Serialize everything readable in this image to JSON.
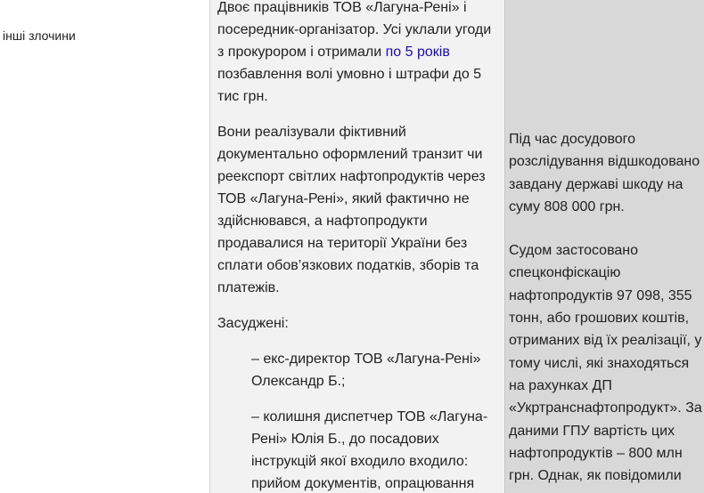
{
  "col1": {
    "label": "інші злочини"
  },
  "col2": {
    "p1_a": "Двоє працівників ТОВ «Лагуна-Рені» і посередник-організатор. Усі уклали угоди з прокурором і отримали ",
    "p1_link": "по 5 років",
    "p1_b": " позбавлення волі умовно і штрафи до 5 тис грн.",
    "p2": "Вони реалізували фіктивний документально оформлений транзит чи реекспорт світлих нафтопродуктів через ТОВ «Лагуна-Рені», який фактично не здійснювався, а нафтопродукти продавалися на території України без сплати обов’язкових податків, зборів та платежів.",
    "p3": "Засуджені:",
    "p4": "– екс-директор ТОВ «Лагуна-Рені» Олександр Б.;",
    "p5": "– колишня диспетчер ТОВ «Лагуна-Рені» Юлія Б., до посадових інструкцій якої входило входило: прийом документів, опрацювання"
  },
  "col3": {
    "p1": "Під час досудового розслідування відшкодовано завдану державі шкоду на суму 808 000 грн.",
    "p2": "Судом застосовано спецконфіскацію нафтопродуктів 97 098, 355 тонн, або грошових коштів, отриманих від їх реалізації, у тому числі, які знаходяться на рахунках ДП «Укртранснафтопродукт». За даними ГПУ вартість цих нафтопродуктів – 800 млн грн. Однак, як повідомили"
  },
  "colors": {
    "col2_bg": "#f2f2f2",
    "col3_bg": "#d8d8d8",
    "link": "#1a0dab",
    "text": "#222222"
  }
}
